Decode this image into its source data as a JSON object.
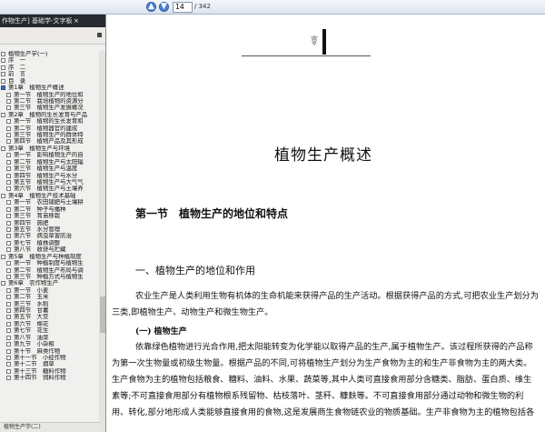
{
  "toolbar": {
    "prev_icon": "arrow-up-icon",
    "next_icon": "arrow-down-icon",
    "page_current": "14",
    "page_total": "/ 342"
  },
  "sidebar": {
    "title": "作物生产] 基础学-文字板",
    "close_icon": "close-icon",
    "items": [
      {
        "label": "植物生产学(一)",
        "level": 0
      },
      {
        "label": "序　一",
        "level": 1
      },
      {
        "label": "序　二",
        "level": 1
      },
      {
        "label": "前　言",
        "level": 1
      },
      {
        "label": "目　录",
        "level": 1
      },
      {
        "label": "第1章　植物生产概述",
        "level": 1,
        "selected": true
      },
      {
        "label": "第一节　植物生产的地位和",
        "level": 2
      },
      {
        "label": "第二节　栽培植物的资源分",
        "level": 2
      },
      {
        "label": "第三节　植物生产发展概况",
        "level": 2
      },
      {
        "label": "第2章　植物的生长发育与产品",
        "level": 1
      },
      {
        "label": "第一节　植物的生长发育和",
        "level": 2
      },
      {
        "label": "第二节　植物器官的建成",
        "level": 2
      },
      {
        "label": "第三节　植物生产的群体特",
        "level": 2
      },
      {
        "label": "第四节　植物产品及其形成",
        "level": 2
      },
      {
        "label": "第3章　植物生产与环境",
        "level": 1
      },
      {
        "label": "第一节　影响植物生产的自",
        "level": 2
      },
      {
        "label": "第二节　植物生产与太阳辐",
        "level": 2
      },
      {
        "label": "第三节　植物生产与温度",
        "level": 2
      },
      {
        "label": "第四节　植物生产与水分",
        "level": 2
      },
      {
        "label": "第五节　植物生产与大气气",
        "level": 2
      },
      {
        "label": "第六节　植物生产与土壤养",
        "level": 2
      },
      {
        "label": "第4章　植物生产技术基础",
        "level": 1
      },
      {
        "label": "第一节　农田铺肥与土壤耕",
        "level": 2
      },
      {
        "label": "第二节　种子与播种",
        "level": 2
      },
      {
        "label": "第三节　育苗移栽",
        "level": 2
      },
      {
        "label": "第四节　施肥",
        "level": 2
      },
      {
        "label": "第五节　水分管理",
        "level": 2
      },
      {
        "label": "第六节　病虫草害防治",
        "level": 2
      },
      {
        "label": "第七节　植株调整",
        "level": 2
      },
      {
        "label": "第八节　收获与贮藏",
        "level": 2
      },
      {
        "label": "第5章　植物生产与种植制度",
        "level": 1
      },
      {
        "label": "第一节　种植制度与植物生",
        "level": 2
      },
      {
        "label": "第二节　植物生产布局与调",
        "level": 2
      },
      {
        "label": "第三节　种植方式与植物生",
        "level": 2
      },
      {
        "label": "第6章　农作物生产",
        "level": 1
      },
      {
        "label": "第一节　小麦",
        "level": 2
      },
      {
        "label": "第二节　玉米",
        "level": 2
      },
      {
        "label": "第三节　水稻",
        "level": 2
      },
      {
        "label": "第四节　甘薯",
        "level": 2
      },
      {
        "label": "第五节　大豆",
        "level": 2
      },
      {
        "label": "第六节　棉花",
        "level": 2
      },
      {
        "label": "第七节　花生",
        "level": 2
      },
      {
        "label": "第八节　油菜",
        "level": 2
      },
      {
        "label": "第九节　小杂粮",
        "level": 2
      },
      {
        "label": "第十节　麻类作物",
        "level": 2
      },
      {
        "label": "第十一节　小经作物",
        "level": 2
      },
      {
        "label": "第十二节　烟草",
        "level": 2
      },
      {
        "label": "第十三节　糖料作物",
        "level": 2
      },
      {
        "label": "第十四节　饲料作物",
        "level": 2
      }
    ],
    "bottom": "植物生产学(二)"
  },
  "doc": {
    "logo_icon": "caduceus-logo-icon",
    "chapter": "植物生产概述",
    "section": "第一节　植物生产的地位和特点",
    "sub1": "一、植物生产的地位和作用",
    "para1": "农业生产是人类利用生物有机体的生命机能来获得产品的生产活动。根据获得产品的方式,可把农业生产划分为三类,即植物生产、动物生产和微生物生产。",
    "sub2": "(一) 植物生产",
    "para2": "依靠绿色植物进行光合作用,把太阳能转变为化学能以取得产品的生产,属于植物生产。该过程所获得的产品称为第一次生物量或初级生物量。根据产品的不同,可将植物生产划分为生产食物为主的和生产非食物为主的两大类。生产食物为主的植物包括粮食、糖料、油料、水果、蔬菜等,其中人类可直接食用部分含糖类、脂肪、蛋白质、维生素等;不可直接食用部分有植物根系残留物、枯枝落叶、茎秆、糠麸等。不可直接食用部分通过动物和微生物的利用、转化,部分地形成人类能够直接食用的食物,这是发展商生食物链农业的物质基础。生产非食物为主的植物包括各"
  }
}
